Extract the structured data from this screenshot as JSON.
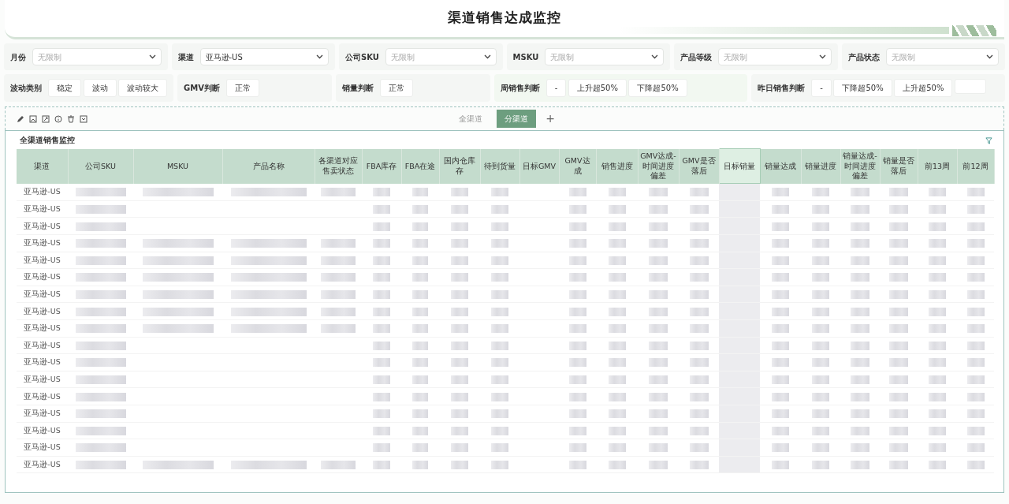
{
  "title": "渠道销售达成监控",
  "filters": [
    {
      "label": "月份",
      "placeholder": "无限制"
    },
    {
      "label": "渠道",
      "value": "亚马逊-US"
    },
    {
      "label": "公司SKU",
      "placeholder": "无限制"
    },
    {
      "label": "MSKU",
      "placeholder": "无限制"
    },
    {
      "label": "产品等级",
      "placeholder": "无限制"
    },
    {
      "label": "产品状态",
      "placeholder": "无限制"
    }
  ],
  "judgments": [
    {
      "label": "波动类别",
      "options": [
        "稳定",
        "波动",
        "波动较大"
      ]
    },
    {
      "label": "GMV判断",
      "options": [
        "正常"
      ]
    },
    {
      "label": "销量判断",
      "options": [
        "正常"
      ]
    },
    {
      "label": "周销售判断",
      "options": [
        "-",
        "上升超50%",
        "下降超50%"
      ]
    },
    {
      "label": "昨日销售判断",
      "options": [
        "-",
        "下降超50%",
        "上升超50%"
      ]
    }
  ],
  "tabs": [
    {
      "label": "全渠道",
      "selected": false
    },
    {
      "label": "分渠道",
      "selected": true
    }
  ],
  "add_tab": "+",
  "table": {
    "title": "全渠道销售监控",
    "columns": [
      {
        "label": "渠道",
        "selected": false
      },
      {
        "label": "公司SKU",
        "selected": false
      },
      {
        "label": "MSKU",
        "selected": false
      },
      {
        "label": "产品名称",
        "selected": false
      },
      {
        "label": "各渠道对应售卖状态",
        "selected": false
      },
      {
        "label": "FBA库存",
        "selected": false
      },
      {
        "label": "FBA在途",
        "selected": false
      },
      {
        "label": "国内仓库存",
        "selected": false
      },
      {
        "label": "待到货量",
        "selected": false
      },
      {
        "label": "目标GMV",
        "selected": false
      },
      {
        "label": "GMV达成",
        "selected": false
      },
      {
        "label": "销售进度",
        "selected": false
      },
      {
        "label": "GMV达成-时间进度偏差",
        "selected": false
      },
      {
        "label": "GMV是否落后",
        "selected": false
      },
      {
        "label": "目标销量",
        "selected": true
      },
      {
        "label": "销量达成",
        "selected": false
      },
      {
        "label": "销量进度",
        "selected": false
      },
      {
        "label": "销量达成-时间进度偏差",
        "selected": false
      },
      {
        "label": "销量是否落后",
        "selected": false
      },
      {
        "label": "前13周",
        "selected": false
      },
      {
        "label": "前12周",
        "selected": false
      }
    ],
    "rows": [
      {
        "channel": "亚马逊-US",
        "kind": "full"
      },
      {
        "channel": "亚马逊-US",
        "kind": "partial"
      },
      {
        "channel": "亚马逊-US",
        "kind": "partial"
      },
      {
        "channel": "亚马逊-US",
        "kind": "full"
      },
      {
        "channel": "亚马逊-US",
        "kind": "full"
      },
      {
        "channel": "亚马逊-US",
        "kind": "full"
      },
      {
        "channel": "亚马逊-US",
        "kind": "full"
      },
      {
        "channel": "亚马逊-US",
        "kind": "full"
      },
      {
        "channel": "亚马逊-US",
        "kind": "full"
      },
      {
        "channel": "亚马逊-US",
        "kind": "partial"
      },
      {
        "channel": "亚马逊-US",
        "kind": "partial"
      },
      {
        "channel": "亚马逊-US",
        "kind": "partial"
      },
      {
        "channel": "亚马逊-US",
        "kind": "partial"
      },
      {
        "channel": "亚马逊-US",
        "kind": "partial"
      },
      {
        "channel": "亚马逊-US",
        "kind": "partial"
      },
      {
        "channel": "亚马逊-US",
        "kind": "partial"
      },
      {
        "channel": "亚马逊-US",
        "kind": "full"
      }
    ]
  }
}
